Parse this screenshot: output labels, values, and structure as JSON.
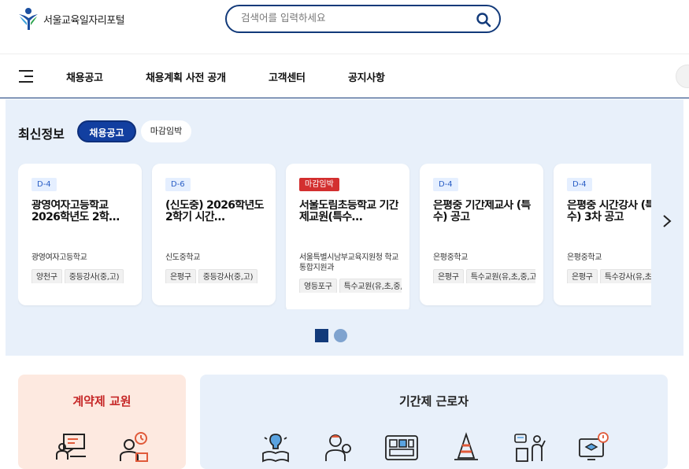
{
  "header": {
    "logo_text": "서울교육일자리포털",
    "search_placeholder": "검색어를 입력하세요"
  },
  "nav": {
    "items": [
      "채용공고",
      "채용계획 사전 공개",
      "고객센터",
      "공지사항"
    ]
  },
  "latest": {
    "title": "최신정보",
    "tabs": [
      {
        "label": "채용공고",
        "active": true
      },
      {
        "label": "마감임박",
        "active": false
      }
    ],
    "cards": [
      {
        "badge": "D-4",
        "badge_type": "dday",
        "title": "광영여자고등학교 2026학년도 2학…",
        "school": "광영여자고등학교",
        "tags": [
          "양천구",
          "중등강사(중,고)"
        ]
      },
      {
        "badge": "D-6",
        "badge_type": "dday",
        "title": "(신도중) 2026학년도 2학기 시간…",
        "school": "신도중학교",
        "tags": [
          "은평구",
          "중등강사(중,고)"
        ]
      },
      {
        "badge": "마감임박",
        "badge_type": "urgent",
        "title": "서울도림초등학교 기간제교원(특수…",
        "school": "서울특별시남부교육지원청 학교통합지원과",
        "tags": [
          "영등포구",
          "특수교원(유,초,중,고)"
        ]
      },
      {
        "badge": "D-4",
        "badge_type": "dday",
        "title": "은평중 기간제교사 (특수) 공고",
        "school": "은평중학교",
        "tags": [
          "은평구",
          "특수교원(유,초,중,고)"
        ]
      },
      {
        "badge": "D-4",
        "badge_type": "dday",
        "title": "은평중 시간강사 (특수) 3차 공고",
        "school": "은평중학교",
        "tags": [
          "은평구",
          "특수강사(유,초,중,고)"
        ]
      }
    ]
  },
  "sections": {
    "contract_title": "계약제 교원",
    "fixed_title": "기간제 근로자"
  },
  "colors": {
    "primary": "#123a7a",
    "accent_blue": "#123fa0",
    "urgent_red": "#d32f2f",
    "contract_bg": "#fde9e0",
    "info_bg": "#e8f0fa"
  }
}
